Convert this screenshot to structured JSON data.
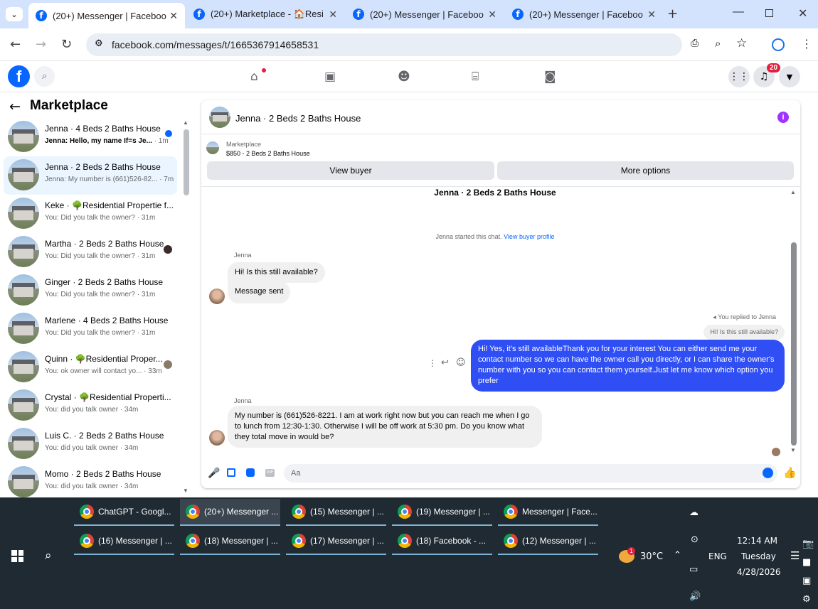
{
  "browser": {
    "tabs": [
      {
        "title": "(20+) Messenger | Facebook",
        "active": true
      },
      {
        "title": "(20+) Marketplace - 🏠Resid"
      },
      {
        "title": "(20+) Messenger | Facebook"
      },
      {
        "title": "(20+) Messenger | Facebook"
      }
    ],
    "url": "facebook.com/messages/t/1665367914658531"
  },
  "fb_header": {
    "notification_count": "20"
  },
  "sidebar": {
    "title": "Marketplace",
    "conversations": [
      {
        "name": "Jenna · 4 Beds 2 Baths House",
        "preview": "Jenna: Hello, my name If=s Je...",
        "time": "· 1m",
        "unread": true
      },
      {
        "name": "Jenna · 2 Beds 2 Baths House",
        "preview": "Jenna: My number is (661)526-82...",
        "time": "· 7m",
        "selected": true
      },
      {
        "name": "Keke · 🌳Residential Propertie f...",
        "preview": "You: Did you talk the owner?",
        "time": "· 31m"
      },
      {
        "name": "Martha · 2 Beds 2 Baths House",
        "preview": "You: Did you talk the owner?",
        "time": "· 31m"
      },
      {
        "name": "Ginger · 2 Beds 2 Baths House",
        "preview": "You: Did you talk the owner?",
        "time": "· 31m"
      },
      {
        "name": "Marlene · 4 Beds 2 Baths House",
        "preview": "You: Did you talk the owner?",
        "time": "· 31m"
      },
      {
        "name": "Quinn · 🌳Residential Proper...",
        "preview": "You: ok owner will contact yo...",
        "time": "· 33m"
      },
      {
        "name": "Crystal · 🌳Residential Properti...",
        "preview": "You: did you talk owner",
        "time": "· 34m"
      },
      {
        "name": "Luis C. · 2 Beds 2 Baths House",
        "preview": "You: did you talk owner",
        "time": "· 34m"
      },
      {
        "name": "Momo · 2 Beds 2 Baths House",
        "preview": "You: did you talk owner",
        "time": "· 34m"
      }
    ]
  },
  "chat": {
    "header_title": "Jenna · 2 Beds 2 Baths House",
    "listing_label": "Marketplace",
    "listing_price": "$850 - 2 Beds 2 Baths House",
    "view_buyer_label": "View buyer",
    "more_options_label": "More options",
    "thread_title": "Jenna · 2 Beds 2 Baths House",
    "started_text": "Jenna started this chat.",
    "view_profile_link": "View buyer profile",
    "sender1": "Jenna",
    "msg1": "Hi! Is this still available?",
    "msg2": "Message sent",
    "replied_label": "You replied to Jenna",
    "replied_quote": "Hi! Is this still available?",
    "my_reply": "Hi! Yes, it's still availableThank you for your interest You can either send me your contact number so we can have the owner call you directly, or I can share the owner's number with you so you can contact them yourself.Just let me know which option you prefer",
    "sender2": "Jenna",
    "msg3": "My number is (661)526-8221. I am at work right now but you can reach me when I go to lunch from 12:30-1:30. Otherwise I will be off work at 5:30 pm. Do you know what they total move in would be?",
    "composer_placeholder": "Aa"
  },
  "taskbar": {
    "row1": [
      "ChatGPT - Googl...",
      "(20+) Messenger ...",
      "(15) Messenger | ...",
      "(19) Messenger | ...",
      "Messenger | Face..."
    ],
    "row2": [
      "(16) Messenger | ...",
      "(18) Messenger | ...",
      "(17) Messenger | ...",
      "(18) Facebook - ...",
      "(12) Messenger | ..."
    ],
    "weather_temp": "30°C",
    "weather_badge": "1",
    "language": "ENG",
    "time": "12:14 AM",
    "day": "Tuesday",
    "date": "4/28/2026"
  },
  "colors": {
    "fb_blue": "#0866ff",
    "bubble_blue": "#2f4ff5",
    "notification_red": "#e41e3f",
    "info_purple": "#a033ff"
  }
}
